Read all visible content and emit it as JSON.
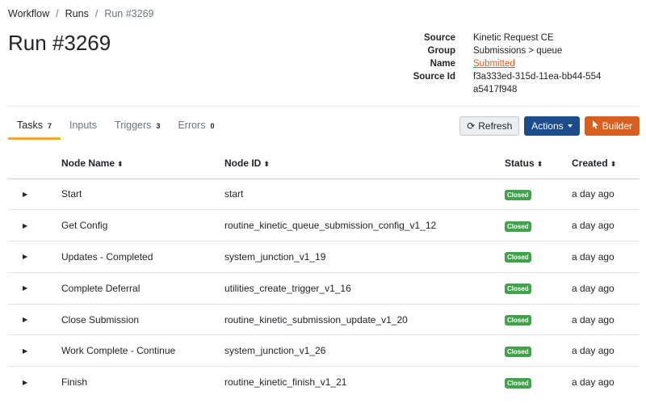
{
  "breadcrumb": {
    "items": [
      "Workflow",
      "Runs"
    ],
    "separator": "/",
    "current": "Run #3269"
  },
  "page_title": "Run #3269",
  "meta": [
    {
      "key": "Source",
      "value": "Kinetic Request CE"
    },
    {
      "key": "Group",
      "value": "Submissions > queue"
    },
    {
      "key": "Name",
      "value": "Submitted"
    },
    {
      "key": "Source Id",
      "value": "f3a333ed-315d-11ea-bb44-554a5417f948"
    }
  ],
  "tabs": [
    {
      "label": "Tasks",
      "count": "7",
      "active": true
    },
    {
      "label": "Inputs",
      "count": ""
    },
    {
      "label": "Triggers",
      "count": "3"
    },
    {
      "label": "Errors",
      "count": "0"
    }
  ],
  "toolbar": {
    "refresh_label": "Refresh",
    "actions_label": "Actions",
    "builder_label": "Builder"
  },
  "table": {
    "headers": [
      "Node Name",
      "Node ID",
      "Status",
      "Created"
    ],
    "rows": [
      {
        "name": "Start",
        "id": "start",
        "status": "Closed",
        "created": "a day ago"
      },
      {
        "name": "Get Config",
        "id": "routine_kinetic_queue_submission_config_v1_12",
        "status": "Closed",
        "created": "a day ago"
      },
      {
        "name": "Updates - Completed",
        "id": "system_junction_v1_19",
        "status": "Closed",
        "created": "a day ago"
      },
      {
        "name": "Complete Deferral",
        "id": "utilities_create_trigger_v1_16",
        "status": "Closed",
        "created": "a day ago"
      },
      {
        "name": "Close Submission",
        "id": "routine_kinetic_submission_update_v1_20",
        "status": "Closed",
        "created": "a day ago"
      },
      {
        "name": "Work Complete - Continue",
        "id": "system_junction_v1_26",
        "status": "Closed",
        "created": "a day ago"
      },
      {
        "name": "Finish",
        "id": "routine_kinetic_finish_v1_21",
        "status": "Closed",
        "created": "a day ago"
      }
    ]
  },
  "colors": {
    "active_tab": "#f0a92e",
    "link": "#dc5c18",
    "actions_button": "#1d4c8c",
    "builder_button": "#d8601f",
    "status_closed": "#3fa449"
  },
  "icons": {
    "refresh": "refresh-icon",
    "builder": "pointer-icon",
    "sort": "sort-icon",
    "expand": "caret-right-icon"
  }
}
